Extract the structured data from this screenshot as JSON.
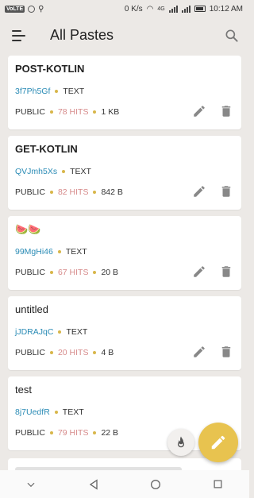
{
  "status_bar": {
    "carrier_badge": "VoLTE",
    "network_speed": "0 K/s",
    "network_type": "4G",
    "time": "10:12 AM"
  },
  "header": {
    "title": "All Pastes",
    "menu_icon": "hamburger-menu-icon",
    "search_icon": "search-icon"
  },
  "pastes": [
    {
      "title": "POST-KOTLIN",
      "id": "3f7Ph5Gf",
      "type": "TEXT",
      "visibility": "PUBLIC",
      "hits": "78 HITS",
      "size": "1 KB"
    },
    {
      "title": "GET-KOTLIN",
      "id": "QVJmh5Xs",
      "type": "TEXT",
      "visibility": "PUBLIC",
      "hits": "82 HITS",
      "size": "842 B"
    },
    {
      "title": "🍉🍉",
      "id": "99MgHi46",
      "type": "TEXT",
      "visibility": "PUBLIC",
      "hits": "67 HITS",
      "size": "20 B"
    },
    {
      "title": "untitled",
      "id": "jJDRAJqC",
      "type": "TEXT",
      "visibility": "PUBLIC",
      "hits": "20 HITS",
      "size": "4 B"
    },
    {
      "title": "test",
      "id": "8j7UedfR",
      "type": "TEXT",
      "visibility": "PUBLIC",
      "hits": "79 HITS",
      "size": "22 B"
    }
  ],
  "colors": {
    "accent": "#e8c34f",
    "paste_id": "#2a8bb5",
    "hits": "#d68a8a",
    "dot": "#d8b64a",
    "background": "#ece9e6"
  },
  "fab": {
    "icon": "pencil-icon"
  },
  "mini_fab": {
    "icon": "flame-icon"
  }
}
